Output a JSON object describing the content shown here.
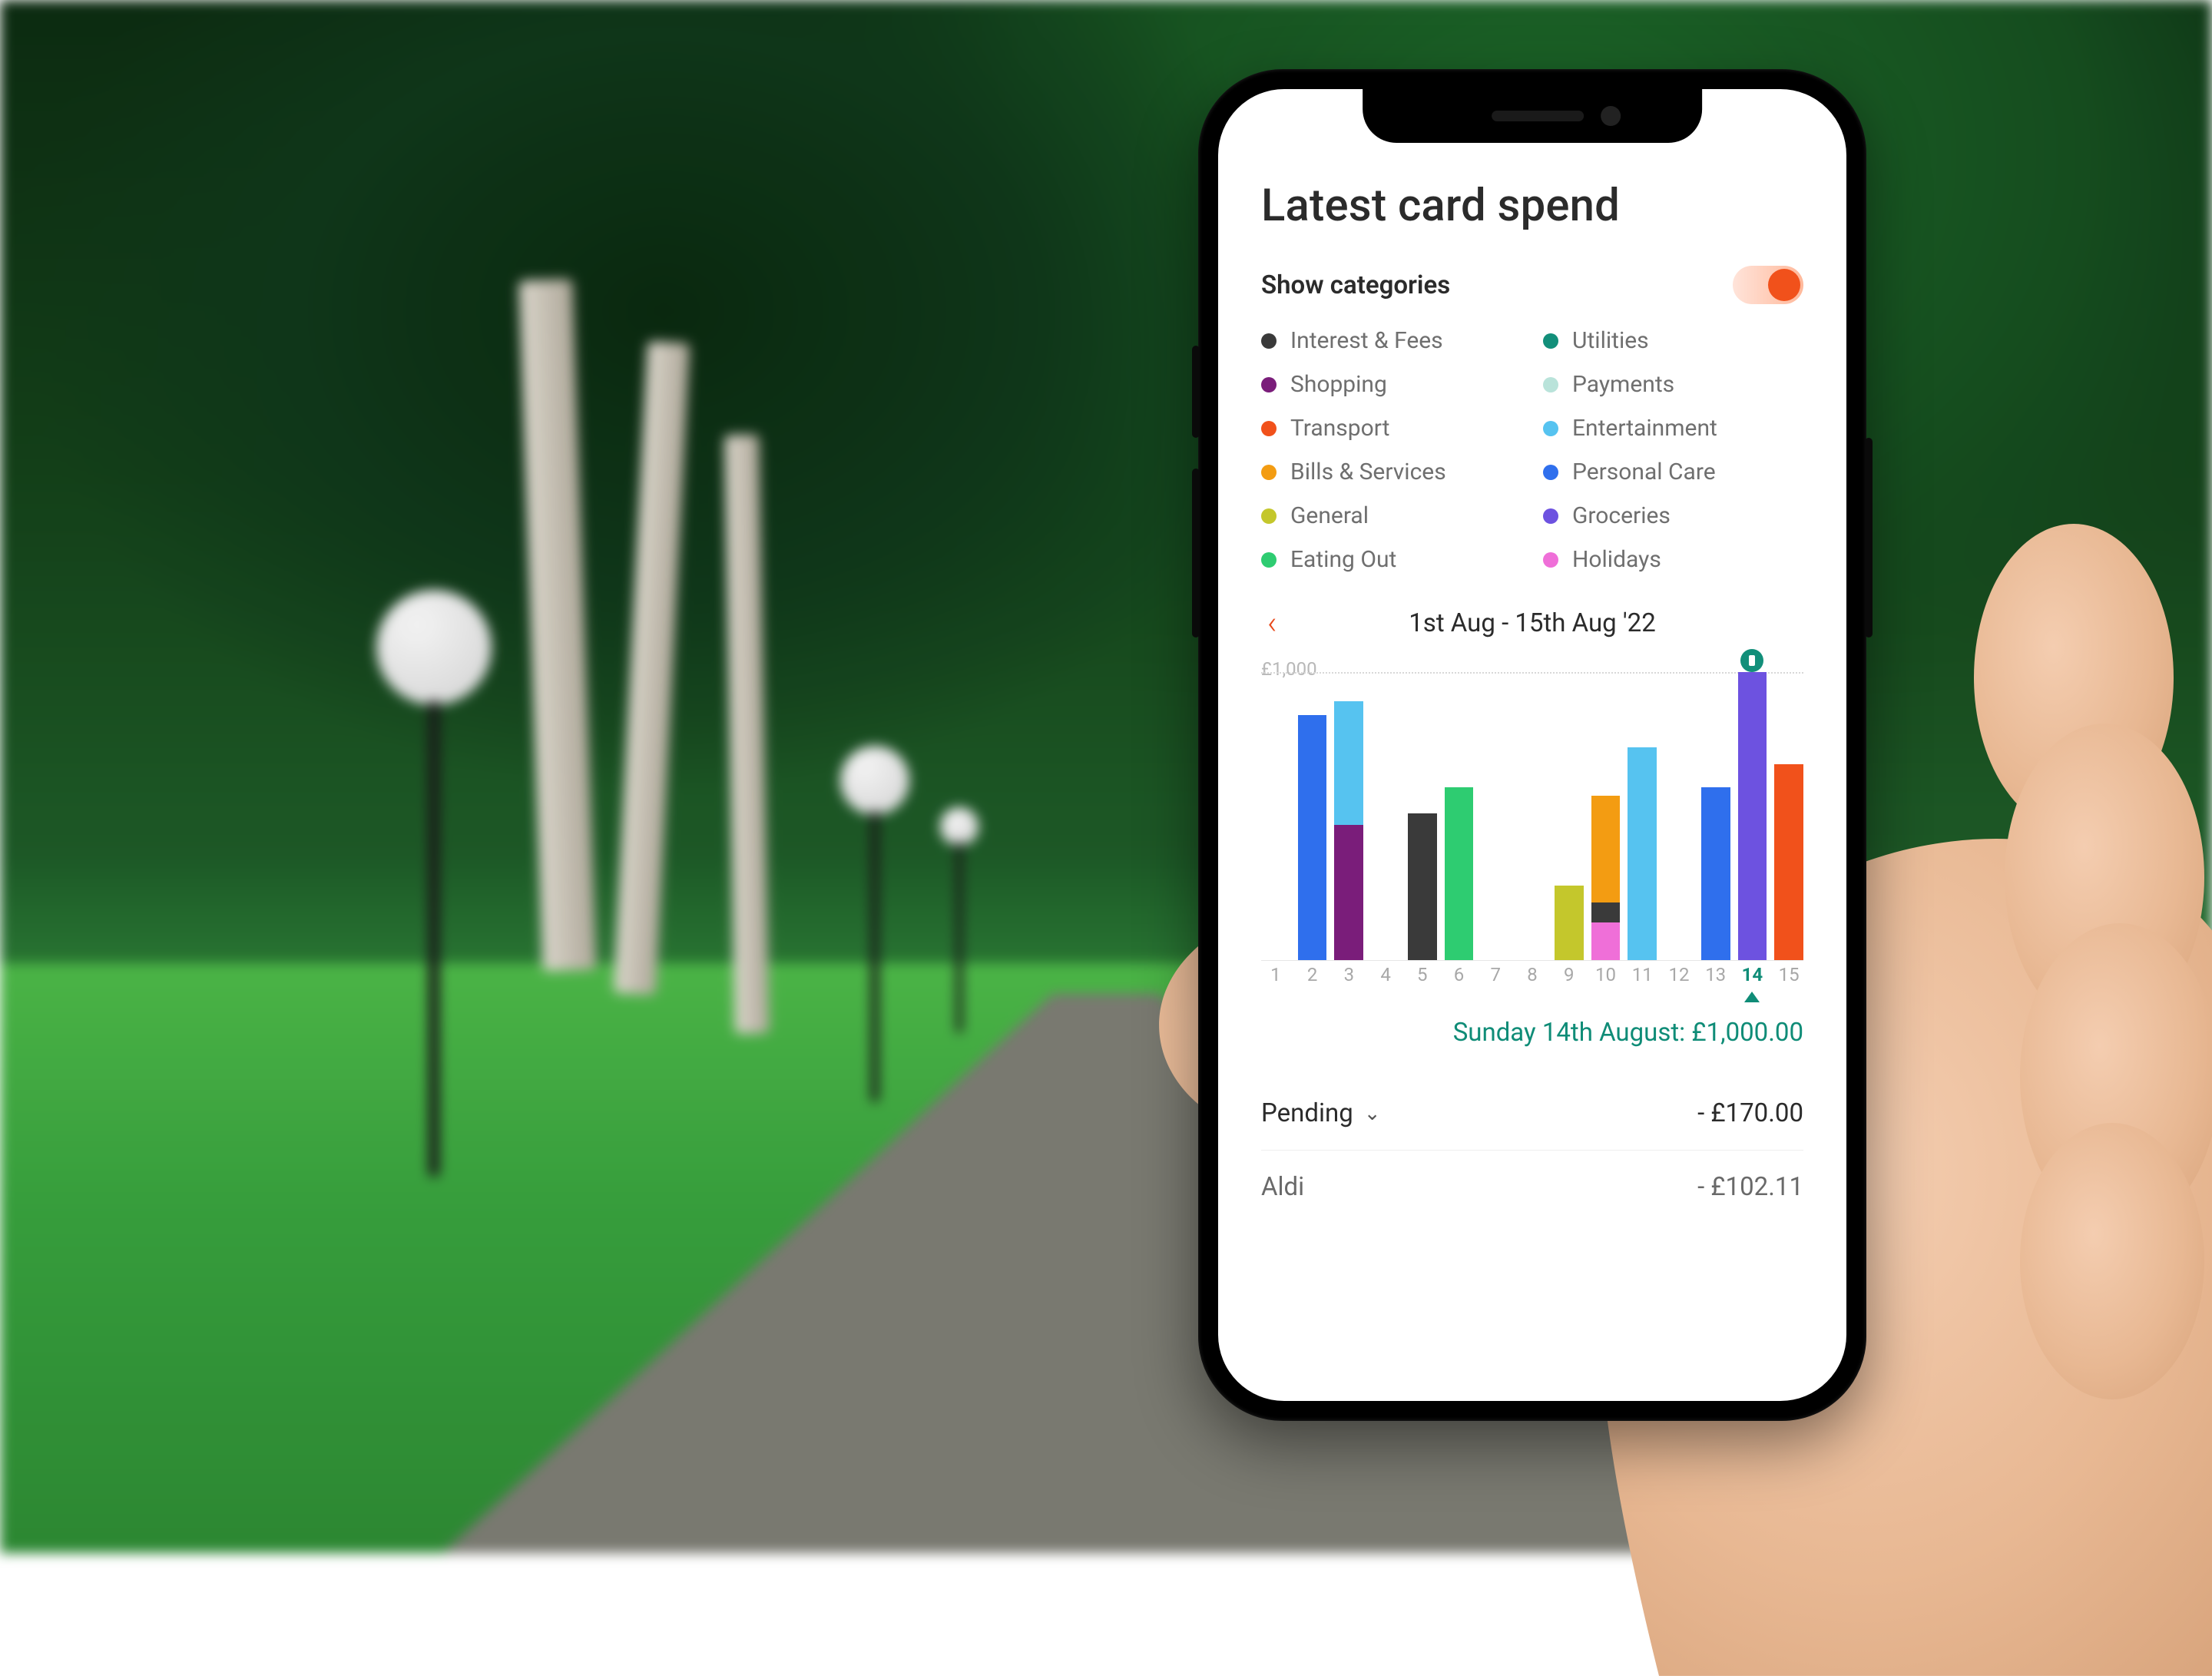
{
  "header": {
    "title": "Latest card spend",
    "show_categories_label": "Show categories"
  },
  "categories": [
    {
      "name": "Interest & Fees",
      "color": "#3a3a3a"
    },
    {
      "name": "Shopping",
      "color": "#7a1d7a"
    },
    {
      "name": "Transport",
      "color": "#f1511b"
    },
    {
      "name": "Bills & Services",
      "color": "#f39c12"
    },
    {
      "name": "General",
      "color": "#c4c72c"
    },
    {
      "name": "Eating Out",
      "color": "#2ecc71"
    },
    {
      "name": "Utilities",
      "color": "#128f7a"
    },
    {
      "name": "Payments",
      "color": "#b9e3da"
    },
    {
      "name": "Entertainment",
      "color": "#56c3f0"
    },
    {
      "name": "Personal Care",
      "color": "#2f6fed"
    },
    {
      "name": "Groceries",
      "color": "#6d52e0"
    },
    {
      "name": "Holidays",
      "color": "#ef6fd8"
    }
  ],
  "range": {
    "label": "1st Aug - 15th Aug '22"
  },
  "chart_data": {
    "type": "bar",
    "ylabel": "£1,000",
    "ylim": [
      0,
      1000
    ],
    "x_labels": [
      "1",
      "2",
      "3",
      "4",
      "5",
      "6",
      "7",
      "8",
      "9",
      "10",
      "11",
      "12",
      "13",
      "14",
      "15"
    ],
    "selected_index": 13,
    "days": [
      {
        "x": "1",
        "segments": []
      },
      {
        "x": "2",
        "segments": [
          {
            "cat": "Personal Care",
            "v": 850
          }
        ]
      },
      {
        "x": "3",
        "segments": [
          {
            "cat": "Entertainment",
            "v": 430
          },
          {
            "cat": "Shopping",
            "v": 470
          }
        ]
      },
      {
        "x": "4",
        "segments": []
      },
      {
        "x": "5",
        "segments": [
          {
            "cat": "Interest & Fees",
            "v": 510
          }
        ]
      },
      {
        "x": "6",
        "segments": [
          {
            "cat": "Eating Out",
            "v": 600
          }
        ]
      },
      {
        "x": "7",
        "segments": []
      },
      {
        "x": "8",
        "segments": []
      },
      {
        "x": "9",
        "segments": [
          {
            "cat": "General",
            "v": 260
          }
        ]
      },
      {
        "x": "10",
        "segments": [
          {
            "cat": "Bills & Services",
            "v": 370
          },
          {
            "cat": "Interest & Fees",
            "v": 70
          },
          {
            "cat": "Holidays",
            "v": 130
          }
        ]
      },
      {
        "x": "11",
        "segments": [
          {
            "cat": "Entertainment",
            "v": 740
          }
        ]
      },
      {
        "x": "12",
        "segments": []
      },
      {
        "x": "13",
        "segments": [
          {
            "cat": "Personal Care",
            "v": 600
          }
        ]
      },
      {
        "x": "14",
        "segments": [
          {
            "cat": "Groceries",
            "v": 1000
          }
        ],
        "badge": true
      },
      {
        "x": "15",
        "segments": [
          {
            "cat": "Transport",
            "v": 680
          }
        ]
      }
    ]
  },
  "selected_summary": "Sunday 14th August: £1,000.00",
  "transactions": [
    {
      "label": "Pending",
      "amount": "- £170.00",
      "expandable": true
    },
    {
      "label": "Aldi",
      "amount": "- £102.11",
      "expandable": false
    }
  ]
}
